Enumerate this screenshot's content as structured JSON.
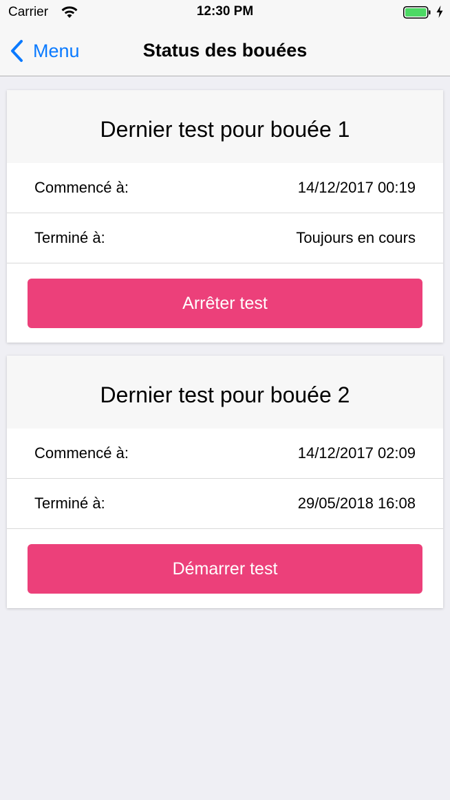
{
  "status_bar": {
    "carrier": "Carrier",
    "time": "12:30 PM",
    "battery_color": "#4cd964"
  },
  "nav": {
    "back_label": "Menu",
    "title": "Status des bouées",
    "accent_color": "#0a7aff"
  },
  "cards": [
    {
      "title": "Dernier test pour bouée 1",
      "rows": [
        {
          "label": "Commencé à:",
          "value": "14/12/2017 00:19"
        },
        {
          "label": "Terminé à:",
          "value": "Toujours en cours"
        }
      ],
      "button_label": "Arrêter test"
    },
    {
      "title": "Dernier test pour bouée 2",
      "rows": [
        {
          "label": "Commencé à:",
          "value": "14/12/2017 02:09"
        },
        {
          "label": "Terminé à:",
          "value": "29/05/2018 16:08"
        }
      ],
      "button_label": "Démarrer test"
    }
  ],
  "button_color": "#ec407a"
}
